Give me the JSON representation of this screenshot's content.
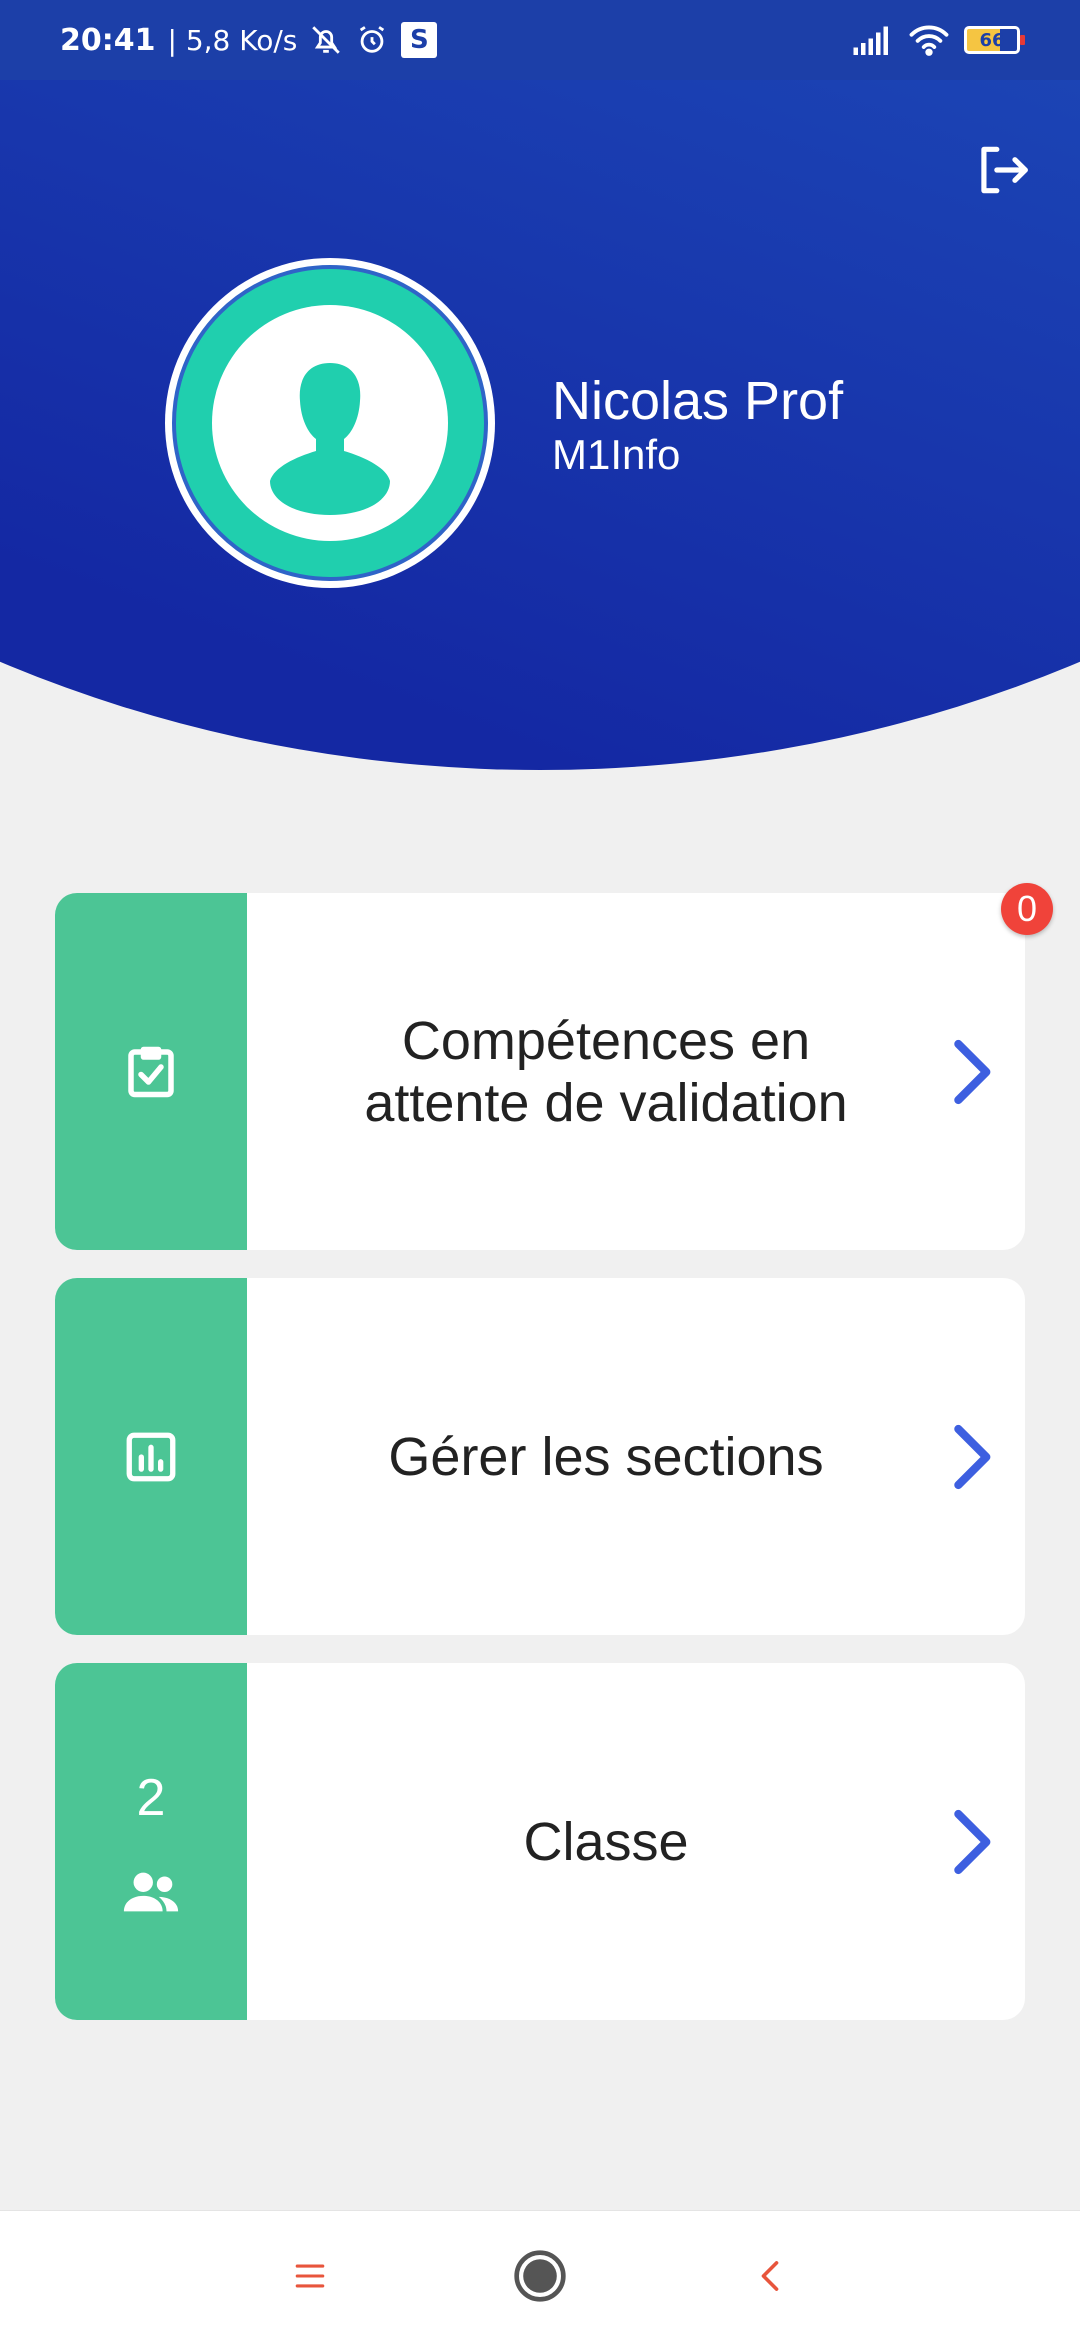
{
  "status_bar": {
    "time": "20:41",
    "network_speed": "| 5,8 Ko/s",
    "s_icon_label": "S",
    "battery_level": "66"
  },
  "profile": {
    "name": "Nicolas Prof",
    "class": "M1Info"
  },
  "cards": [
    {
      "label": "Compétences en attente de validation",
      "badge": "0",
      "icon": "clipboard-check-icon"
    },
    {
      "label": "Gérer les sections",
      "icon": "bar-chart-icon"
    },
    {
      "label": "Classe",
      "count": "2",
      "icon": "group-icon"
    }
  ],
  "colors": {
    "header_gradient_start": "#2f7fd3",
    "header_gradient_end": "#1428a3",
    "card_side": "#4cc595",
    "chevron": "#3d5fe0",
    "badge": "#f0433a",
    "avatar": "#20cfae",
    "nav_icon": "#e8553c"
  }
}
